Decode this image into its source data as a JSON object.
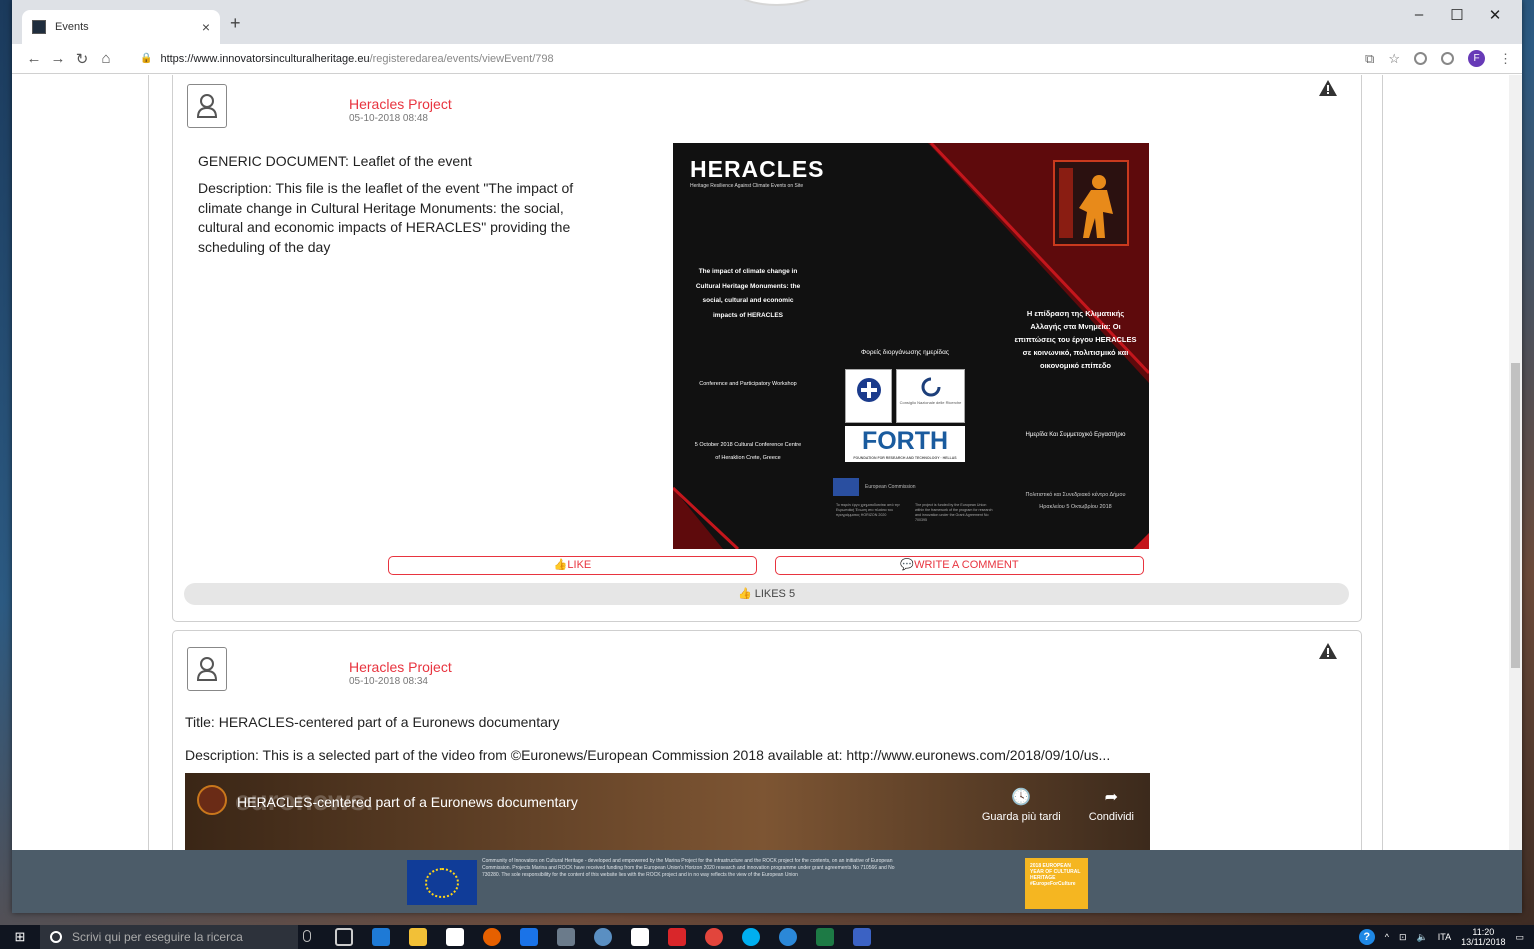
{
  "browser": {
    "tab_title": "Events",
    "tab_close": "×",
    "new_tab": "+",
    "window_controls": [
      "–",
      "☐",
      "✕"
    ],
    "url_main": "https://www.innovatorsinculturalheritage.eu",
    "url_path": "/registeredarea/events/viewEvent/798",
    "profile_initial": "F"
  },
  "post1": {
    "author": "Heracles Project",
    "date": "05-10-2018 08:48",
    "doc_title": "GENERIC DOCUMENT: Leaflet of the event",
    "description": "Description: This file is the leaflet of the event \"The impact of climate change in Cultural Heritage Monuments: the social, cultural and economic impacts of HERACLES\" providing the scheduling of the day",
    "like_label": "LIKE",
    "comment_label": "WRITE A COMMENT",
    "likes_label": "LIKES 5"
  },
  "leaflet": {
    "title": "HERACLES",
    "subtitle": "Heritage Resilience Against Climate Events on Site",
    "left_heading": "The impact of climate change in Cultural Heritage Monuments: the social, cultural and economic impacts of HERACLES",
    "left_event": "Conference and Participatory Workshop",
    "left_venue": "5 October 2018 Cultural Conference Centre of Heraklion Crete, Greece",
    "mid_title": "Φορείς διοργάνωσης ημερίδας",
    "logo2_text": "Consiglio Nazionale delle Ricerche",
    "forth_text": "FORTH",
    "forth_sub": "FOUNDATION FOR RESEARCH AND TECHNOLOGY · HELLAS",
    "eu_text": "European Commission",
    "right_heading": "Η επίδραση της Κλιματικής Αλλαγής στα Μνημεία: Οι επιπτώσεις του έργου HERACLES σε κοινωνικό, πολιτισμικό και οικονομικό επίπεδο",
    "right_event": "Ημερίδα Και Συμμετοχικό Εργαστήριο",
    "right_venue": "Πολιτιστικό και Συνεδριακό κέντρο Δήμου Ηρακλείου 5 Οκτωβρίου 2018",
    "fine_left": "Το παρόν έργο χρηματοδοτείται από την Ευρωπαϊκή Ένωση στο πλαίσιο του προγράμματος HORIZON 2020",
    "fine_right": "The project is funded by the European Union within the framework of the program for research and innovation under the Grant Agreement No 700395"
  },
  "post2": {
    "author": "Heracles Project",
    "date": "05-10-2018 08:34",
    "title": "Title: HERACLES-centered part of a Euronews documentary",
    "description": "Description: This is a selected part of the video from ©Euronews/European Commission 2018 available at: http://www.euronews.com/2018/09/10/us...",
    "video_title": "HERACLES-centered part of a Euronews documentary",
    "watch_later": "Guarda più tardi",
    "share": "Condividi",
    "watermark": "euronews."
  },
  "footer": {
    "text": "Community of Innovators on Cultural Heritage - developed and empowered by the Marina Project for the infrastructure and the ROCK project for the contents, on an initiative of European Commission. Projects Marina and ROCK have received funding from the European Union's Horizon 2020 research and innovation programme under grant agreements No 710566 and No 730280. The sole responsibility for the content of this website lies with the ROCK project and in no way reflects the view of the European Union",
    "eych_text": "2018 EUROPEAN YEAR OF CULTURAL HERITAGE #EuropeForCulture"
  },
  "taskbar": {
    "search_placeholder": "Scrivi qui per eseguire la ricerca",
    "language": "ITA",
    "time": "11:20",
    "date": "13/11/2018"
  },
  "colors": {
    "accent": "#e8343f",
    "footer_bg": "#4c5c69",
    "taskbar_bg": "#101520"
  }
}
